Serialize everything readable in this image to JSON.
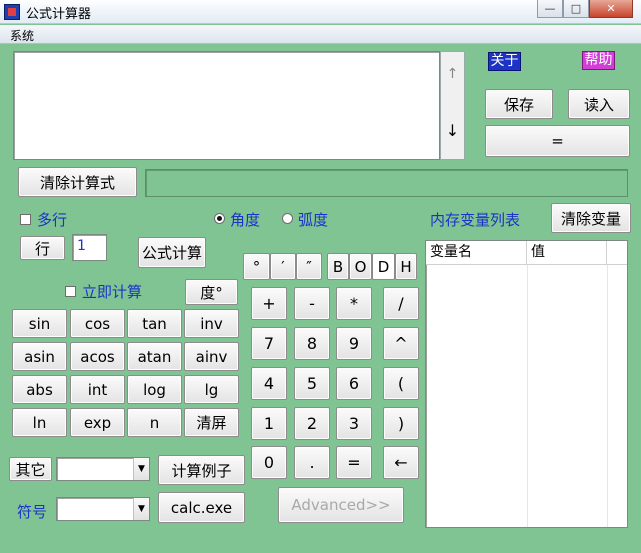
{
  "window": {
    "title": "公式计算器",
    "minimize": "—",
    "maximize": "□",
    "close": "✕"
  },
  "menu": {
    "system": "系统"
  },
  "scroll": {
    "up": "↑",
    "down": "↓"
  },
  "top_right": {
    "about": "关于",
    "help": "帮助",
    "save": "保存",
    "load": "读入",
    "equals": "="
  },
  "clear_formula": "清除计算式",
  "options": {
    "multiline": "多行",
    "degree": "角度",
    "radian": "弧度",
    "line_label": "行",
    "line_value": "1",
    "formula_calc": "公式计算",
    "instant_calc": "立即计算",
    "deg_button": "度°"
  },
  "angle_marks": [
    "°",
    "′",
    "″"
  ],
  "radix": [
    "B",
    "O",
    "D",
    "H"
  ],
  "radix_selected": "D",
  "func_rows": [
    [
      "sin",
      "cos",
      "tan",
      "inv"
    ],
    [
      "asin",
      "acos",
      "atan",
      "ainv"
    ],
    [
      "abs",
      "int",
      "log",
      "lg"
    ],
    [
      "ln",
      "exp",
      "n",
      "清屏"
    ]
  ],
  "keypad_rows": [
    [
      "+",
      "-",
      "*",
      "/"
    ],
    [
      "7",
      "8",
      "9",
      "^"
    ],
    [
      "4",
      "5",
      "6",
      "("
    ],
    [
      "1",
      "2",
      "3",
      ")"
    ],
    [
      "0",
      ".",
      "=",
      "←"
    ]
  ],
  "bottom": {
    "other_label": "其它",
    "examples": "计算例子",
    "symbol_label": "符号",
    "calc_exe": "calc.exe",
    "advanced": "Advanced>>",
    "other_value": "",
    "symbol_value": ""
  },
  "memory": {
    "title": "内存变量列表",
    "clear_vars": "清除变量",
    "col_name": "变量名",
    "col_value": "值"
  },
  "colors": {
    "background": "#7fc492",
    "label_blue": "#1c33c8",
    "about_bg": "#1c33c8",
    "help_bg": "#d23fd6"
  }
}
